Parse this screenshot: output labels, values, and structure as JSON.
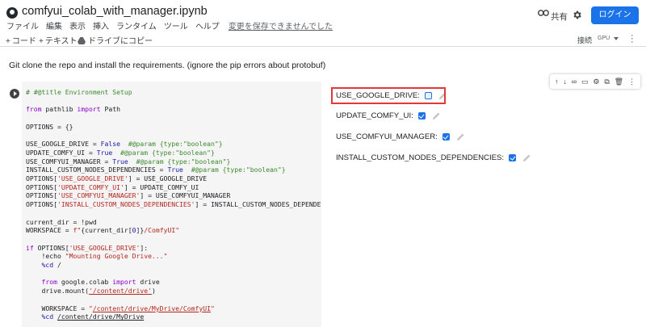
{
  "header": {
    "title": "comfyui_colab_with_manager.ipynb",
    "share_label": "共有",
    "login_label": "ログイン",
    "menus": [
      "ファイル",
      "編集",
      "表示",
      "挿入",
      "ランタイム",
      "ツール",
      "ヘルプ"
    ],
    "unsaved_notice": "変更を保存できませんでした"
  },
  "toolbar": {
    "code_label": "コード",
    "text_label": "テキスト",
    "drive_copy_label": "ドライブにコピー",
    "connect_label": "接続",
    "runtime_label": "GPU"
  },
  "text_cell": "Git clone the repo and install the requirements. (ignore the pip errors about protobuf)",
  "form": {
    "fields": [
      {
        "label": "USE_GOOGLE_DRIVE:",
        "checked": false
      },
      {
        "label": "UPDATE_COMFY_UI:",
        "checked": true
      },
      {
        "label": "USE_COMFYUI_MANAGER:",
        "checked": true
      },
      {
        "label": "INSTALL_CUSTOM_NODES_DEPENDENCIES:",
        "checked": true
      }
    ]
  },
  "cell_tools": [
    "move-up-icon",
    "move-down-icon",
    "link-icon",
    "comment-icon",
    "settings-icon",
    "mirror-cell-icon",
    "delete-icon",
    "more-icon"
  ],
  "colors": {
    "accent": "#1a73e8",
    "highlight": "#e53935",
    "code_background": "#f5f5f5"
  }
}
